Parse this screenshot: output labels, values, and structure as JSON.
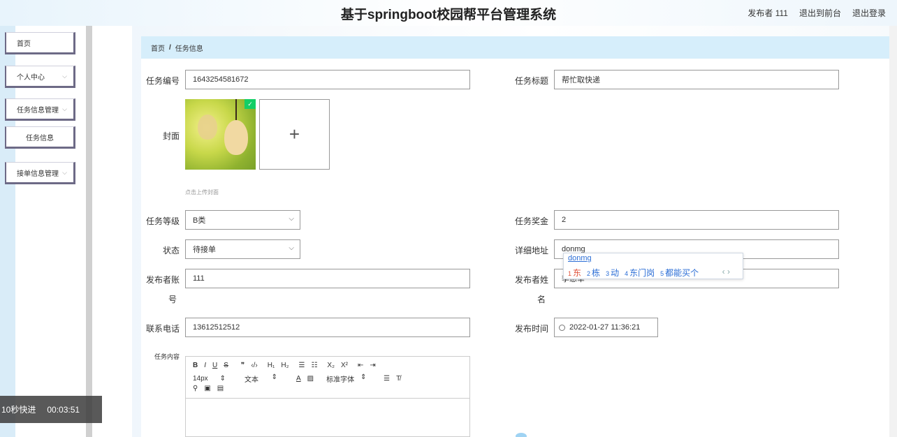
{
  "header": {
    "title": "基于springboot校园帮平台管理系统",
    "user": "发布者 111",
    "back_front": "退出到前台",
    "logout": "退出登录"
  },
  "sidebar": {
    "items": [
      {
        "label": "首页"
      },
      {
        "label": "个人中心"
      },
      {
        "label": "任务信息管理"
      },
      {
        "label": "任务信息"
      },
      {
        "label": "接单信息管理"
      }
    ]
  },
  "breadcrumb": {
    "home": "首页",
    "sep": "/",
    "current": "任务信息"
  },
  "form": {
    "task_no_label": "任务编号",
    "task_no": "1643254581672",
    "task_title_label": "任务标题",
    "task_title": "帮忙取快递",
    "cover_label": "封面",
    "upload_plus": "+",
    "upload_hint": "点击上传封面",
    "level_label": "任务等级",
    "level": "B类",
    "reward_label": "任务奖金",
    "reward": "2",
    "status_label": "状态",
    "status": "待接单",
    "address_label": "详细地址",
    "address": "donmg",
    "account_label_1": "发布者账",
    "account_label_2": "号",
    "account": "111",
    "name_label_1": "发布者姓",
    "name_label_2": "名",
    "name": "李慈幸",
    "phone_label": "联系电话",
    "phone": "13612512512",
    "time_label": "发布时间",
    "time": "2022-01-27 11:36:21",
    "content_label": "任务内容"
  },
  "ime": {
    "typed": "donmg",
    "candidates": [
      "东",
      "栋",
      "动",
      "东门岗",
      "都能买个"
    ],
    "nav": "‹ ›"
  },
  "editor": {
    "row1": [
      "B",
      "I",
      "U",
      "S",
      "❞",
      "‹/›",
      "H₁",
      "H₂",
      "☰",
      "☷",
      "X₂",
      "X²",
      "⇤",
      "⇥"
    ],
    "font_size": "14px",
    "text_type": "文本",
    "font_family": "标准字体"
  },
  "video": {
    "skip": "10秒快进",
    "time": "00:03:51"
  }
}
